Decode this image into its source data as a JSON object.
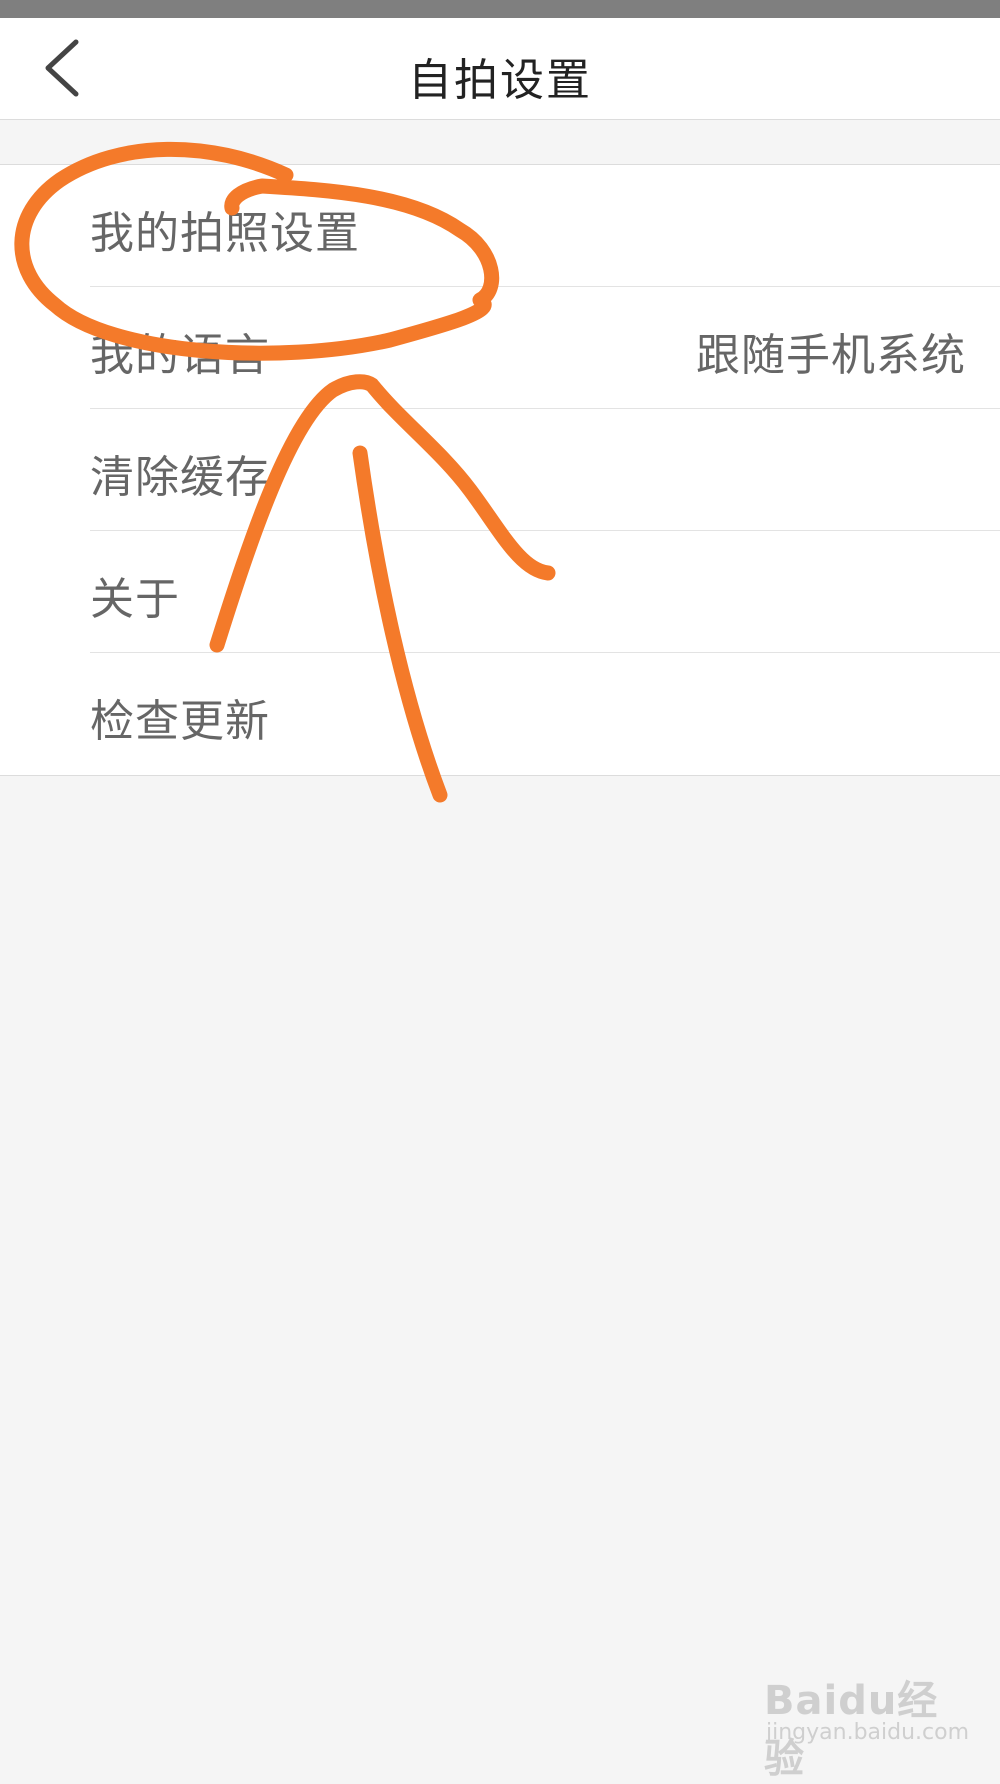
{
  "header": {
    "title": "自拍设置"
  },
  "menu": [
    {
      "label": "我的拍照设置",
      "value": ""
    },
    {
      "label": "我的语言",
      "value": "跟随手机系统"
    },
    {
      "label": "清除缓存",
      "value": ""
    },
    {
      "label": "关于",
      "value": ""
    },
    {
      "label": "检查更新",
      "value": ""
    }
  ],
  "watermark": {
    "logo": "Baidu经验",
    "url": "jingyan.baidu.com"
  },
  "colors": {
    "annotation": "#f47a2a",
    "background": "#f5f5f5",
    "text": "#666666"
  },
  "icons": {
    "back": "chevron-left-icon"
  }
}
